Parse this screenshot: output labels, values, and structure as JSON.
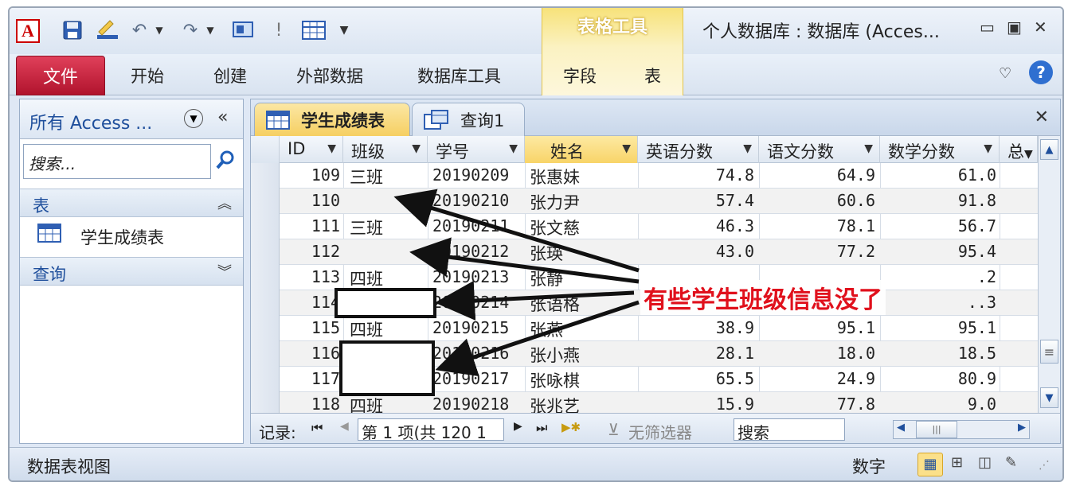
{
  "window": {
    "title": "个人数据库 : 数据库 (Acces...",
    "app_logo": "A",
    "tool_group_title": "表格工具",
    "controls": [
      "▭",
      "▣",
      "✕"
    ]
  },
  "ribbon": {
    "file_tab": "文件",
    "tabs": [
      "开始",
      "创建",
      "外部数据",
      "数据库工具"
    ],
    "tool_tabs": [
      "字段",
      "表"
    ]
  },
  "nav_pane": {
    "title": "所有 Access ...",
    "search_placeholder": "搜索...",
    "groups": [
      {
        "label": "表",
        "items": [
          "学生成绩表"
        ]
      },
      {
        "label": "查询",
        "items": []
      }
    ]
  },
  "document": {
    "tabs": [
      {
        "label": "学生成绩表",
        "active": true
      },
      {
        "label": "查询1",
        "active": false
      }
    ]
  },
  "table": {
    "columns": [
      "ID",
      "班级",
      "学号",
      "姓名",
      "英语分数",
      "语文分数",
      "数学分数",
      "总"
    ],
    "rows": [
      [
        "109",
        "三班",
        "20190209",
        "张惠妹",
        "74.8",
        "64.9",
        "61.0"
      ],
      [
        "110",
        "",
        "20190210",
        "张力尹",
        "57.4",
        "60.6",
        "91.8"
      ],
      [
        "111",
        "三班",
        "20190211",
        "张文慈",
        "46.3",
        "78.1",
        "56.7"
      ],
      [
        "112",
        "",
        "20190212",
        "张瑛",
        "43.0",
        "77.2",
        "95.4"
      ],
      [
        "113",
        "四班",
        "20190213",
        "张静",
        "",
        "",
        ".2"
      ],
      [
        "114",
        "",
        "20190214",
        "张语格",
        "",
        "",
        "..3"
      ],
      [
        "115",
        "四班",
        "20190215",
        "张燕",
        "38.9",
        "95.1",
        "95.1"
      ],
      [
        "116",
        "",
        "20190216",
        "张小燕",
        "28.1",
        "18.0",
        "18.5"
      ],
      [
        "117",
        "",
        "20190217",
        "张咏棋",
        "65.5",
        "24.9",
        "80.9"
      ],
      [
        "118",
        "四班",
        "20190218",
        "张兆艺",
        "15.9",
        "77.8",
        "9.0"
      ]
    ]
  },
  "record_bar": {
    "label": "记录:",
    "position": "第 1 项(共 120 1",
    "filter": "无筛选器",
    "search": "搜索"
  },
  "status_bar": {
    "left": "数据表视图",
    "right": "数字"
  },
  "annotation": {
    "text": "有些学生班级信息没了",
    "color": "#e0101c"
  }
}
